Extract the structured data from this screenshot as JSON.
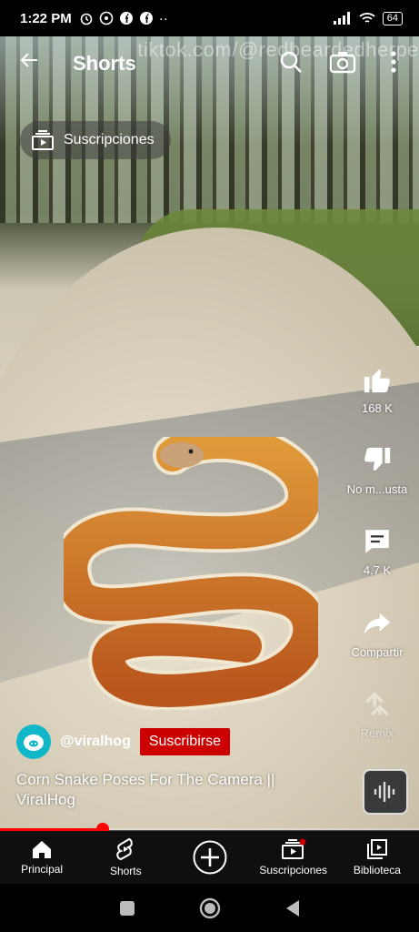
{
  "status_bar": {
    "time": "1:22 PM",
    "battery": "64",
    "notification_icons": [
      "alarm-icon",
      "whatsapp-icon",
      "facebook-icon",
      "facebook-icon",
      "more-dots-icon"
    ]
  },
  "top_bar": {
    "title": "Shorts",
    "watermark": "tiktok.com/@redbeardedherpe"
  },
  "subscriptions_chip": {
    "label": "Suscripciones"
  },
  "actions": {
    "like": {
      "label": "168 K"
    },
    "dislike": {
      "label": "No m...usta"
    },
    "comments": {
      "label": "4.7 K"
    },
    "share": {
      "label": "Compartir"
    },
    "remix": {
      "label": "Remix"
    }
  },
  "video": {
    "channel": "@viralhog",
    "subscribe_label": "Suscribirse",
    "title": "Corn Snake Poses For The Camera || ViralHog",
    "progress": 0.245
  },
  "bottom_nav": {
    "items": [
      {
        "label": "Principal",
        "icon": "home-icon"
      },
      {
        "label": "Shorts",
        "icon": "shorts-icon"
      },
      {
        "label": "",
        "icon": "create-plus-icon"
      },
      {
        "label": "Suscripciones",
        "icon": "subscriptions-icon"
      },
      {
        "label": "Biblioteca",
        "icon": "library-icon"
      }
    ]
  },
  "colors": {
    "accent": "#cc0000",
    "progress": "#ff0000",
    "avatar": "#0fb7c9"
  }
}
